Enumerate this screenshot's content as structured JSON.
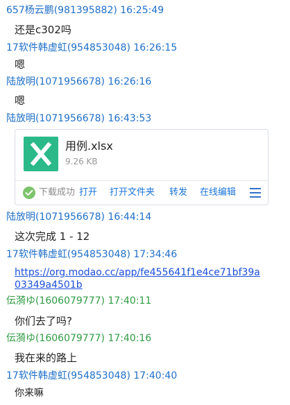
{
  "messages": [
    {
      "sender": "657杨云鹏(981395882) 16:25:49",
      "text": "还是c302吗"
    },
    {
      "sender": "17软件韩虚虹(954853048) 16:26:15",
      "text": "嗯"
    },
    {
      "sender": "陆放明(1071956678) 16:26:16",
      "text": "嗯"
    },
    {
      "sender": "陆放明(1071956678) 16:43:53"
    },
    {
      "sender": "陆放明(1071956678) 16:44:14",
      "text": "这次完成 1 - 12"
    },
    {
      "sender": "17软件韩虚虹(954853048) 17:34:46",
      "link": "https://org.modao.cc/app/fe455641f1e4ce71bf39a03349a4501b"
    },
    {
      "sender": "伝漪ゆ(1606079777) 17:40:11",
      "text": "你们去了吗?"
    },
    {
      "sender": "伝漪ゆ(1606079777) 17:40:16",
      "text": "我在来的路上"
    },
    {
      "sender": "17软件韩虚虹(954853048) 17:40:40",
      "text": "你来嘛"
    }
  ],
  "file": {
    "name": "用例.xlsx",
    "size": "9.26 KB",
    "icon": "excel-file-icon",
    "icon_color": "#2bb98a",
    "status": "下载成功",
    "actions": [
      "打开",
      "打开文件夹",
      "转发",
      "在线编辑"
    ]
  },
  "colors": {
    "sender_blue": "#1f6fc7",
    "sender_green": "#2f9b43",
    "link": "#1a4fd6",
    "action": "#1a74d6"
  }
}
